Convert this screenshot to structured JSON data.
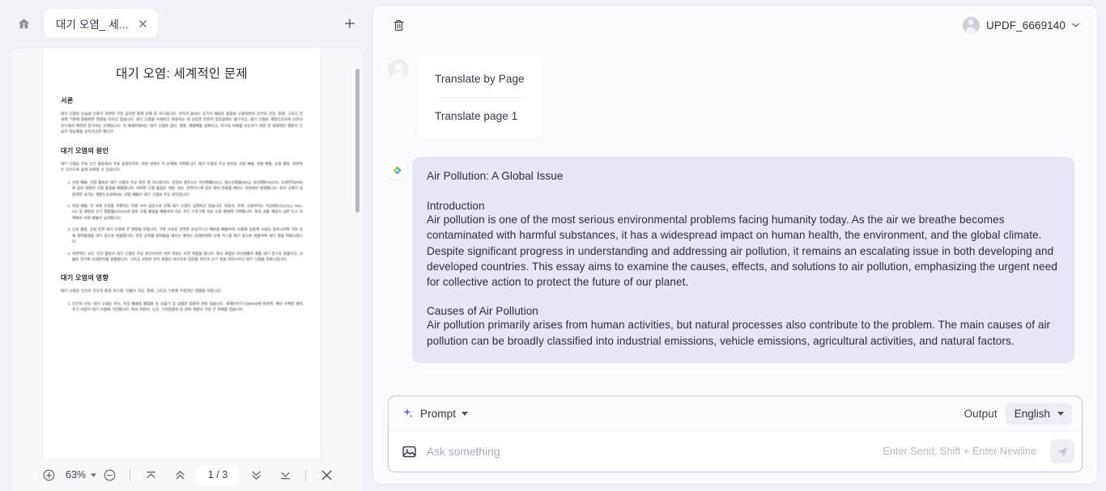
{
  "left_panel": {
    "home_icon": "home-icon",
    "tab": {
      "label": "대기 오염_ 세...",
      "close_icon": "close-icon"
    },
    "new_tab_icon": "plus-icon",
    "document": {
      "title": "대기 오염: 세계적인 문제",
      "sections": [
        {
          "heading": "서론",
          "paragraphs": [
            "대기 오염은 오늘날 인류가 직면한 가장 심각한 환경 문제 중 하나입니다. 우리가 숨쉬는 공기가 해로운 물질로 오염되면서 인간의 건강, 환경, 그리고 전 세계 기후에 광범위한 영향을 미치고 있습니다. 대기 오염을 이해하고 대응하는 데 상당한 진전이 있었음에도 불구하고, 대기 오염은 개발도상국과 선진국 모두에서 여전히 증가하는 문제입니다. 이 에세이에서는 대기 오염의 원인, 영향, 해결책을 살펴보고, 지구의 미래를 보호하기 위한 전 세계적인 행동이 긴급히 필요함을 강조하고자 합니다."
          ]
        },
        {
          "heading": "대기 오염의 원인",
          "paragraphs": [
            "대기 오염은 주로 인간 활동에서 주로 발생하지만, 자연 과정도 이 문제에 기여합니다. 대기 오염의 주요 원인은 산업 배출, 차량 배출, 농업 활동, 자연적인 요인으로 넓게 분류할 수 있습니다."
          ],
          "list": [
            "산업 배출: 산업 활동은 대기 오염의 주요 원인 중 하나입니다. 공장과 발전소는 이산화황(SO₂), 질소산화물(NOₓ), 일산화탄소(CO), 미세먼지(PM)와 같은 대량의 오염 물질을 배출합니다. 이러한 오염 물질은 석탄, 석유, 천연가스와 같은 화석 연료를 태우는 과정에서 발생합니다. 특히 규제가 덜 엄격한 국가는 개발도상국에서는 산업 배출이 대기 오염의 주요 원인입니다.",
            "차량 배출: 전 세계 도로를 주행하는 차량 수의 급증으로 인해 대기 오염이 심화되고 있습니다. 자동차, 트럭, 오토바이는 이산화탄소(CO₂), NOₓ, CO 및 휘발성 유기 화합물(VOCs)과 같은 오염 물질을 배출하며 이는 모두 스모그와 지상 오존 형성에 기여합니다. 특히 교통 체증이 심한 도시 지역에서 차량 배출이 심각합니다.",
            "농업 활동: 농업 또한 대기 오염에 큰 영향을 미칩니다. 가축 사육은 강력한 온실가스인 메탄을 배출하며, 비료와 살충제 사용은 암모니아와 기타 유해 화학물질을 대기 중으로 방출합니다. 또한 농작물 잔여물을 태우는 행위는 미세먼지와 유해 가스를 대기 중으로 방출하여 대기 질을 악화시킵니다.",
            "자연적인 요인: 인간 활동이 대기 오염의 주요 원인이지만 자연 과정도 또한 역할을 합니다. 화산 폭발은 이산화황과 재를 대기 중으로 방출하고, 산불은 연기와 미세먼지를 방출합니다. 그리고 사막의 먼지 폭풍은 대규모로 입자를 퍼뜨려 공기 질을 저하시키고 대기 오염을 악화시킵니다."
          ]
        },
        {
          "heading": "대기 오염의 영향",
          "paragraphs": [
            "대기 오염은 인간의 건강과 환경 모두에, 더불어 건강, 환경, 그리고 기후에 부정적인 영향을 미칩니다."
          ],
          "list": [
            "인간의 건강: 대기 오염은 천식, 만성 폐쇄성 폐질환 등 호흡기 및 심혈관 질환과 관련 있습니다. 세계보건기구(WHO)에 따르면, 매년 수백만 명의 조기 사망이 대기 오염에 기인합니다. 특히 어린이, 노인, 기저질환자 등 취약 계층이 가장 큰 피해를 입습니다."
          ]
        }
      ]
    },
    "toolbar": {
      "zoom_in_icon": "zoom-in-icon",
      "zoom_level": "63%",
      "zoom_caret_icon": "chevron-down-icon",
      "zoom_out_icon": "zoom-out-icon",
      "first_page_icon": "first-page-icon",
      "prev_page_icon": "prev-page-icon",
      "page_indicator": "1 / 3",
      "next_page_icon": "next-page-icon",
      "last_page_icon": "last-page-icon",
      "close_icon": "close-icon"
    }
  },
  "right_panel": {
    "header": {
      "trash_icon": "trash-icon",
      "user_name": "UPDF_6669140",
      "user_caret_icon": "chevron-down-icon",
      "avatar_icon": "avatar-icon"
    },
    "messages": [
      {
        "role": "user",
        "avatar_icon": "avatar-icon",
        "items": [
          "Translate by Page",
          "Translate page 1"
        ]
      },
      {
        "role": "assistant",
        "badge_icon": "ai-sparkle-icon",
        "title": "Air Pollution: A Global Issue",
        "blocks": [
          {
            "heading": "Introduction",
            "body": "Air pollution is one of the most serious environmental problems facing humanity today. As the air we breathe becomes contaminated with harmful substances, it has a widespread impact on human health, the environment, and the global climate. Despite significant progress in understanding and addressing air pollution, it remains an escalating issue in both developing and developed countries. This essay aims to examine the causes, effects, and solutions to air pollution, emphasizing the urgent need for collective action to protect the future of our planet."
          },
          {
            "heading": "Causes of Air Pollution",
            "body": "Air pollution primarily arises from human activities, but natural processes also contribute to the problem. The main causes of air pollution can be broadly classified into industrial emissions, vehicle emissions, agricultural activities, and natural factors."
          }
        ]
      }
    ],
    "composer": {
      "sparkle_icon": "sparkle-icon",
      "prompt_label": "Prompt",
      "prompt_caret_icon": "chevron-down-icon",
      "output_label": "Output",
      "language_value": "English",
      "language_caret_icon": "chevron-down-icon",
      "image_icon": "image-icon",
      "input_value": "",
      "input_placeholder": "Ask something",
      "hint": "Enter Send; Shift + Enter Newline",
      "send_icon": "send-icon"
    }
  },
  "colors": {
    "accent": "#7b68ee",
    "ai_bubble": "#e7e6f5",
    "composer_border": "#c3c2e8",
    "app_bg": "#f1f2f7"
  }
}
